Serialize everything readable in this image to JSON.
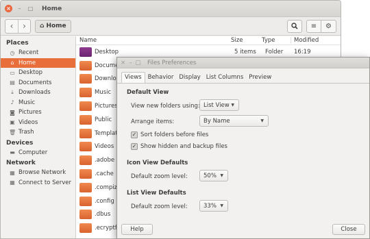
{
  "main_window": {
    "title": "Home",
    "path_button": "Home",
    "sidebar": {
      "places_heading": "Places",
      "places": [
        {
          "label": "Recent",
          "icon": "clock-icon"
        },
        {
          "label": "Home",
          "icon": "home-icon",
          "active": true
        },
        {
          "label": "Desktop",
          "icon": "desktop-icon"
        },
        {
          "label": "Documents",
          "icon": "document-icon"
        },
        {
          "label": "Downloads",
          "icon": "download-icon"
        },
        {
          "label": "Music",
          "icon": "music-icon"
        },
        {
          "label": "Pictures",
          "icon": "camera-icon"
        },
        {
          "label": "Videos",
          "icon": "video-icon"
        },
        {
          "label": "Trash",
          "icon": "trash-icon"
        }
      ],
      "devices_heading": "Devices",
      "devices": [
        {
          "label": "Computer",
          "icon": "drive-icon"
        }
      ],
      "network_heading": "Network",
      "network": [
        {
          "label": "Browse Network",
          "icon": "network-icon"
        },
        {
          "label": "Connect to Server",
          "icon": "server-icon"
        }
      ]
    },
    "columns": {
      "name": "Name",
      "size": "Size",
      "type": "Type",
      "modified": "Modified"
    },
    "rows": [
      {
        "name": "Desktop",
        "size": "5 items",
        "type": "Folder",
        "modified": "16:19",
        "icon": "desktop-folder-icon"
      },
      {
        "name": "Documents",
        "icon": "folder-icon"
      },
      {
        "name": "Downloads",
        "icon": "folder-icon"
      },
      {
        "name": "Music",
        "icon": "folder-icon"
      },
      {
        "name": "Pictures",
        "icon": "folder-icon"
      },
      {
        "name": "Public",
        "icon": "folder-icon"
      },
      {
        "name": "Templates",
        "icon": "folder-icon"
      },
      {
        "name": "Videos",
        "icon": "folder-icon"
      },
      {
        "name": ".adobe",
        "icon": "folder-icon"
      },
      {
        "name": ".cache",
        "icon": "folder-icon"
      },
      {
        "name": ".compiz",
        "icon": "folder-icon"
      },
      {
        "name": ".config",
        "icon": "folder-icon"
      },
      {
        "name": ".dbus",
        "icon": "folder-icon"
      },
      {
        "name": ".ecryptfs",
        "icon": "folder-icon"
      }
    ]
  },
  "preferences_dialog": {
    "title": "Files Preferences",
    "tabs": [
      "Views",
      "Behavior",
      "Display",
      "List Columns",
      "Preview"
    ],
    "active_tab": "Views",
    "default_view": {
      "heading": "Default View",
      "view_new_folders_label": "View new folders using:",
      "view_new_folders_value": "List View",
      "arrange_items_label": "Arrange items:",
      "arrange_items_value": "By Name",
      "sort_folders_label": "Sort folders before files",
      "sort_folders_checked": true,
      "show_hidden_label": "Show hidden and backup files",
      "show_hidden_checked": true
    },
    "icon_view": {
      "heading": "Icon View Defaults",
      "zoom_label": "Default zoom level:",
      "zoom_value": "50%"
    },
    "list_view": {
      "heading": "List View Defaults",
      "zoom_label": "Default zoom level:",
      "zoom_value": "33%"
    },
    "help_button": "Help",
    "close_button": "Close"
  },
  "colors": {
    "accent": "#e86f3c",
    "folder": "#e07a45",
    "window_bg": "#f2f1f0"
  }
}
